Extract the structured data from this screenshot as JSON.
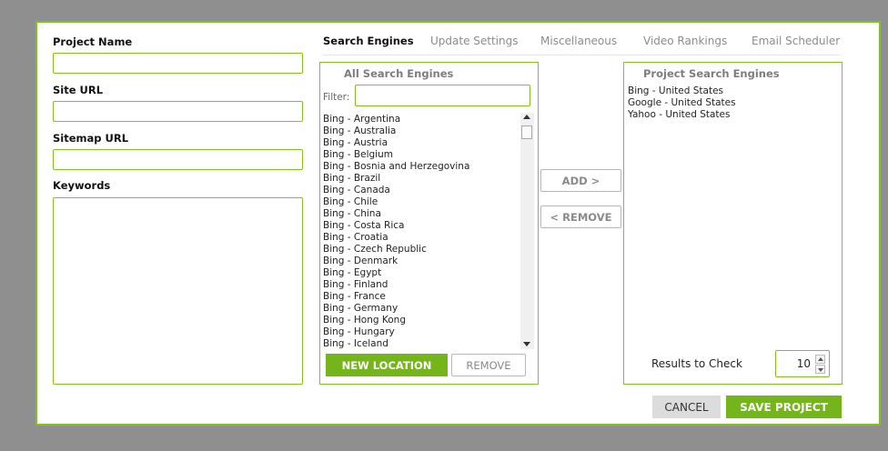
{
  "form": {
    "project_name_label": "Project Name",
    "project_name_value": "",
    "site_url_label": "Site URL",
    "site_url_value": "",
    "sitemap_url_label": "Sitemap URL",
    "sitemap_url_value": "",
    "keywords_label": "Keywords",
    "keywords_value": ""
  },
  "tabs": [
    {
      "label": "Search Engines",
      "active": true
    },
    {
      "label": "Update Settings",
      "active": false
    },
    {
      "label": "Miscellaneous",
      "active": false
    },
    {
      "label": "Video Rankings",
      "active": false
    },
    {
      "label": "Email Scheduler",
      "active": false
    }
  ],
  "all_engines": {
    "title": "All Search Engines",
    "filter_label": "Filter:",
    "filter_value": "",
    "items": [
      "Bing - Argentina",
      "Bing - Australia",
      "Bing - Austria",
      "Bing - Belgium",
      "Bing - Bosnia and Herzegovina",
      "Bing - Brazil",
      "Bing - Canada",
      "Bing - Chile",
      "Bing - China",
      "Bing - Costa Rica",
      "Bing - Croatia",
      "Bing - Czech Republic",
      "Bing - Denmark",
      "Bing - Egypt",
      "Bing - Finland",
      "Bing - France",
      "Bing - Germany",
      "Bing - Hong Kong",
      "Bing - Hungary",
      "Bing - Iceland"
    ],
    "new_location_label": "NEW LOCATION",
    "remove_label": "REMOVE"
  },
  "transfer": {
    "add_label": "ADD >",
    "remove_label": "< REMOVE"
  },
  "project_engines": {
    "title": "Project Search Engines",
    "items": [
      "Bing - United States",
      "Google - United States",
      "Yahoo - United States"
    ],
    "results_label": "Results to Check",
    "results_value": "10"
  },
  "footer": {
    "cancel_label": "CANCEL",
    "save_label": "SAVE PROJECT"
  },
  "colors": {
    "accent": "#80c31c",
    "button_green": "#73b51b",
    "overlay": "#8f8f8f"
  }
}
